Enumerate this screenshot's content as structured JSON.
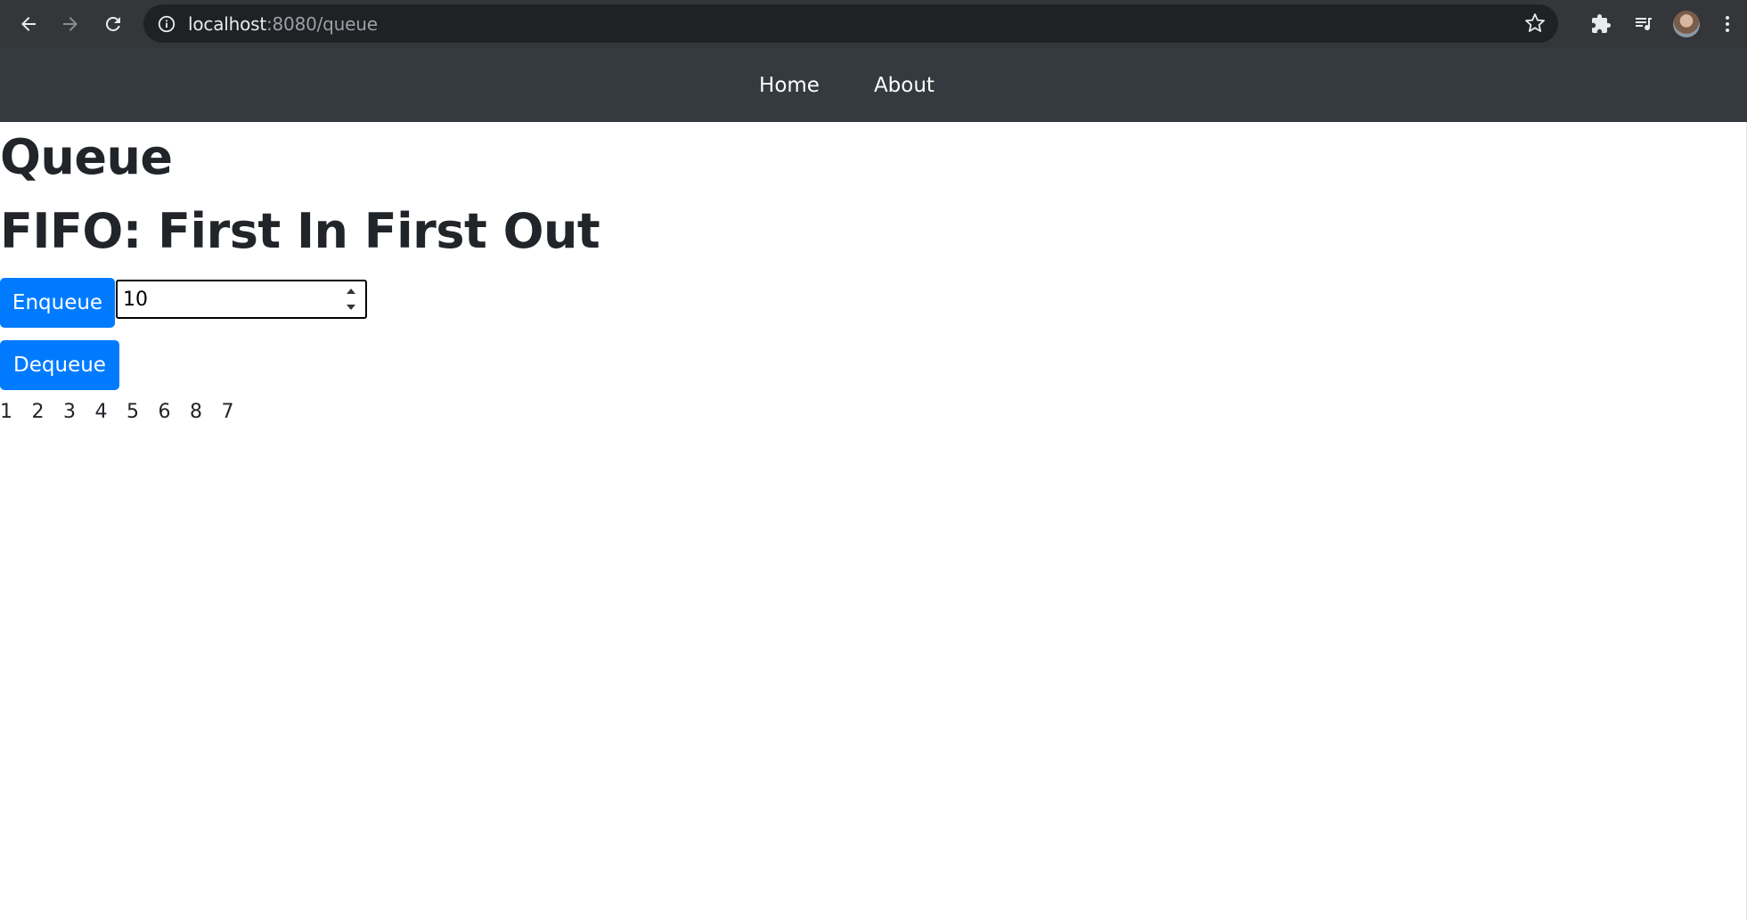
{
  "browser": {
    "url_host": "localhost",
    "url_path": ":8080/queue",
    "icons": [
      "back-arrow-icon",
      "forward-arrow-icon",
      "reload-icon",
      "info-icon",
      "star-icon",
      "extensions-icon",
      "media-queue-icon",
      "profile-avatar",
      "more-menu-icon"
    ]
  },
  "navbar": {
    "home_label": "Home",
    "about_label": "About",
    "background": "#343a40"
  },
  "page": {
    "title": "Queue",
    "subtitle": "FIFO: First In First Out",
    "enqueue_label": "Enqueue",
    "dequeue_label": "Dequeue",
    "input_value": "10",
    "accent": "#007bff"
  },
  "queue": {
    "items": [
      "1",
      "2",
      "3",
      "4",
      "5",
      "6",
      "8",
      "7"
    ]
  }
}
